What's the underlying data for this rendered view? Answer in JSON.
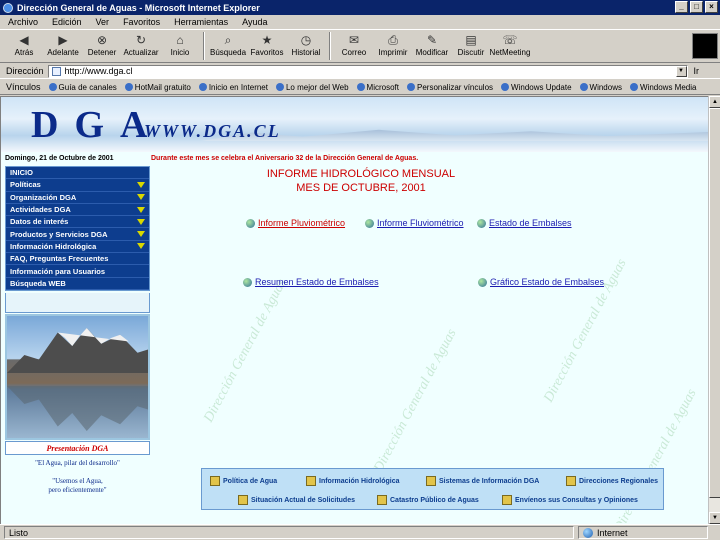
{
  "window": {
    "title": "Dirección General de Aguas - Microsoft Internet Explorer",
    "buttons": [
      "_",
      "□",
      "×"
    ]
  },
  "menubar": [
    "Archivo",
    "Edición",
    "Ver",
    "Favoritos",
    "Herramientas",
    "Ayuda"
  ],
  "toolbar": [
    {
      "label": "Atrás",
      "icon": "back-arrow-icon"
    },
    {
      "label": "Adelante",
      "icon": "forward-arrow-icon"
    },
    {
      "label": "Detener",
      "icon": "stop-icon"
    },
    {
      "label": "Actualizar",
      "icon": "refresh-icon"
    },
    {
      "label": "Inicio",
      "icon": "home-icon"
    },
    {
      "label": "Búsqueda",
      "icon": "search-icon"
    },
    {
      "label": "Favoritos",
      "icon": "favorites-icon"
    },
    {
      "label": "Historial",
      "icon": "history-icon"
    },
    {
      "label": "Correo",
      "icon": "mail-icon"
    },
    {
      "label": "Imprimir",
      "icon": "print-icon"
    },
    {
      "label": "Modificar",
      "icon": "edit-icon"
    },
    {
      "label": "Discutir",
      "icon": "discuss-icon"
    },
    {
      "label": "NetMeeting",
      "icon": "netmeeting-icon"
    }
  ],
  "address": {
    "label": "Dirección",
    "url": "http://www.dga.cl",
    "go_label": "Ir"
  },
  "links": {
    "label": "Vínculos",
    "items": [
      "Guía de canales",
      "HotMail gratuito",
      "Inicio en Internet",
      "Lo mejor del Web",
      "Microsoft",
      "Personalizar vínculos",
      "Windows Update",
      "Windows",
      "Windows Media"
    ]
  },
  "banner": {
    "logo_text": "DGA",
    "url_text": "WWW.DGA.CL"
  },
  "page": {
    "date_line": "Domingo, 21 de Octubre de 2001",
    "marquee": "Durante este mes se celebra el Aniversario 32 de la Dirección General de Aguas.",
    "report_title_line1": "INFORME HIDROLÓGICO MENSUAL",
    "report_title_line2": "MES DE OCTUBRE, 2001",
    "links": {
      "informe_pluviometrico": "Informe Pluviométrico",
      "informe_fluviometrico": "Informe Fluviométrico",
      "estado_embalses": "Estado de Embalses",
      "resumen_embalses": "Resumen Estado de Embalses",
      "grafico_embalses": "Gráfico Estado de Embalses"
    },
    "presentacion": "Presentación DGA",
    "quote1": "\"El Agua, pilar del desarrollo\"",
    "quote2_line1": "\"Usemos el Agua,",
    "quote2_line2": "pero eficientemente\"",
    "watermark_text": "Dirección General de Aguas"
  },
  "leftmenu": [
    {
      "label": "INICIO",
      "arrow": false
    },
    {
      "label": "Políticas",
      "arrow": true
    },
    {
      "label": "Organización DGA",
      "arrow": true
    },
    {
      "label": "Actividades DGA",
      "arrow": true
    },
    {
      "label": "Datos de interés",
      "arrow": true
    },
    {
      "label": "Productos y Servicios DGA",
      "arrow": true
    },
    {
      "label": "Información Hidrológica",
      "arrow": true
    },
    {
      "label": "FAQ, Preguntas Frecuentes",
      "arrow": false
    },
    {
      "label": "Información para Usuarios",
      "arrow": false
    },
    {
      "label": "Búsqueda WEB",
      "arrow": false
    }
  ],
  "bottomnav": {
    "politica_agua": "Política de Agua",
    "info_hidrologica": "Información Hidrológica",
    "sistemas_info": "Sistemas de Información DGA",
    "direcciones_regionales": "Direcciones Regionales",
    "situacion_solicitudes": "Situación Actual de Solicitudes",
    "catastro": "Catastro Público de Aguas",
    "envienos": "Envíenos sus Consultas y Opiniones"
  },
  "status": {
    "text": "Listo",
    "zone": "Internet"
  },
  "colors": {
    "titlebar": "#0a246a",
    "menu_bg": "#0d3d8e",
    "page_bg": "#f0ffff",
    "report_title": "#cc0000",
    "link": "#1b1bb0"
  }
}
